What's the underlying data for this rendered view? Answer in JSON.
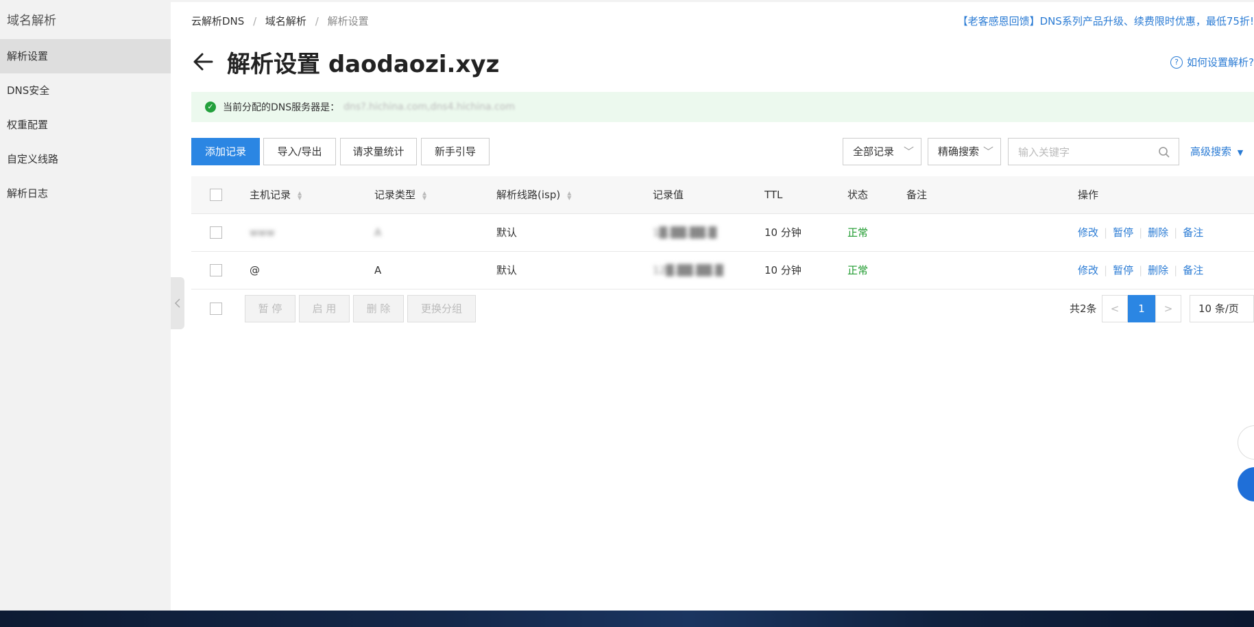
{
  "sidebar": {
    "title": "域名解析",
    "items": [
      {
        "label": "解析设置",
        "active": true
      },
      {
        "label": "DNS安全",
        "active": false
      },
      {
        "label": "权重配置",
        "active": false
      },
      {
        "label": "自定义线路",
        "active": false
      },
      {
        "label": "解析日志",
        "active": false
      }
    ]
  },
  "breadcrumb": [
    "云解析DNS",
    "域名解析",
    "解析设置"
  ],
  "promo": "【老客感恩回馈】DNS系列产品升级、续费限时优惠，最低75折!",
  "page": {
    "title": "解析设置 daodaozi.xyz",
    "help_link": "如何设置解析?"
  },
  "dns_banner": {
    "label": "当前分配的DNS服务器是：",
    "value": "dns?.hichina.com,dns4.hichina.com"
  },
  "toolbar": {
    "add": "添加记录",
    "import_export": "导入/导出",
    "stats": "请求量统计",
    "guide": "新手引导",
    "filter_select": "全部记录",
    "search_mode": "精确搜索",
    "search_placeholder": "输入关键字",
    "advanced": "高级搜索"
  },
  "table": {
    "columns": [
      "主机记录",
      "记录类型",
      "解析线路(isp)",
      "记录值",
      "TTL",
      "状态",
      "备注",
      "操作"
    ],
    "rows": [
      {
        "host": "www",
        "type": "A",
        "line": "默认",
        "value": "1█.██.██.█",
        "ttl": "10 分钟",
        "status": "正常",
        "note": ""
      },
      {
        "host": "@",
        "type": "A",
        "line": "默认",
        "value": "12█.██.██.█",
        "ttl": "10 分钟",
        "status": "正常",
        "note": ""
      }
    ],
    "row_actions": [
      "修改",
      "暂停",
      "删除",
      "备注"
    ]
  },
  "bulk": {
    "pause": "暂 停",
    "enable": "启 用",
    "delete": "删 除",
    "change_group": "更换分组"
  },
  "pagination": {
    "total": "共2条",
    "prev": "<",
    "current": "1",
    "next": ">",
    "page_size": "10 条/页"
  },
  "colors": {
    "accent": "#2b86e3",
    "link": "#2a7bd4",
    "success": "#1e9a2e",
    "banner_bg": "#ecf9ee"
  }
}
